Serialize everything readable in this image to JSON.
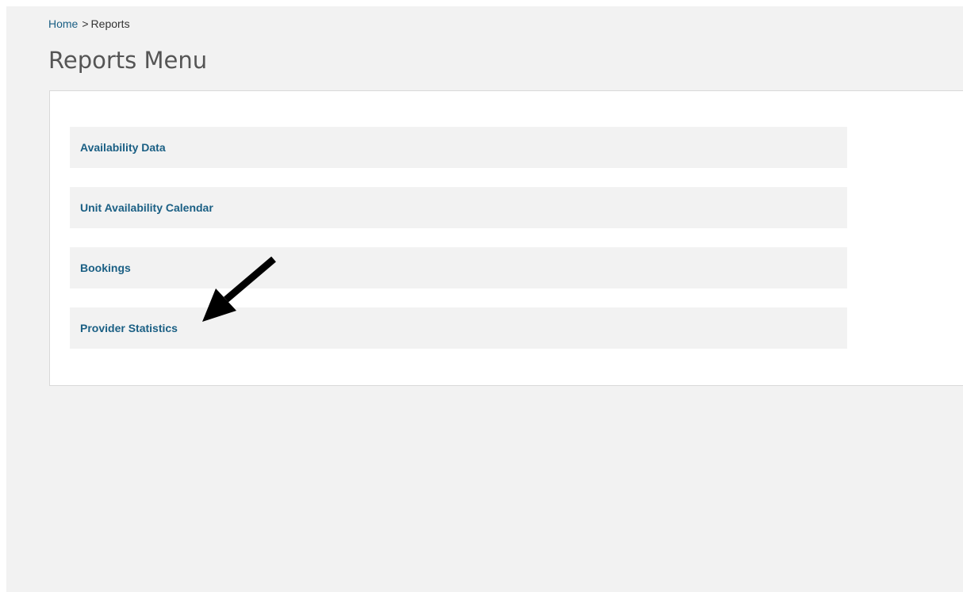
{
  "breadcrumb": {
    "home": "Home",
    "separator": ">",
    "current": "Reports"
  },
  "page_title": "Reports Menu",
  "menu": {
    "items": [
      {
        "label": "Availability Data"
      },
      {
        "label": "Unit Availability Calendar"
      },
      {
        "label": "Bookings"
      },
      {
        "label": "Provider Statistics"
      }
    ]
  },
  "annotation": {
    "icon": "arrow-annotation-icon",
    "color": "#000000"
  },
  "colors": {
    "link": "#1a5f84",
    "background": "#f2f2f2",
    "panel": "#ffffff"
  }
}
